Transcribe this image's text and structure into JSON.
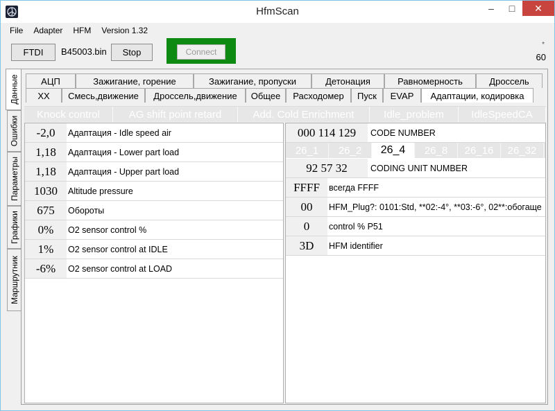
{
  "window": {
    "title": "HfmScan",
    "minimize": "–",
    "maximize": "□",
    "close": "✕"
  },
  "menu": [
    "File",
    "Adapter",
    "HFM",
    "Version 1.32"
  ],
  "toolbar": {
    "ftdi": "FTDI",
    "file": "B45003.bin",
    "stop": "Stop",
    "connect": "Connect",
    "star": "*",
    "count": "60"
  },
  "vtabs": [
    "Данные",
    "Ошибки",
    "Параметры",
    "Графики",
    "Маршрутник"
  ],
  "tabs_row1": [
    "АЦП",
    "Зажигание, горение",
    "Зажигание, пропуски",
    "Детонация",
    "Равномерность",
    "Дроссель"
  ],
  "tabs_row2": [
    "ХХ",
    "Смесь,движение",
    "Дроссель,движение",
    "Общее",
    "Расходомер",
    "Пуск",
    "EVAP",
    "Адаптации, кодировка"
  ],
  "subtabs": [
    "Knock control",
    "AG shift point retard",
    "Add. Cold Enrichment",
    "Idle_problem",
    "IdleSpeedCA"
  ],
  "left_rows": [
    {
      "value": "-2,0",
      "label": "Адаптация - Idle speed air"
    },
    {
      "value": "1,18",
      "label": "Адаптация - Lower part load"
    },
    {
      "value": "1,18",
      "label": "Адаптация - Upper part load"
    },
    {
      "value": "1030",
      "label": "Altitude pressure"
    },
    {
      "value": "675",
      "label": "Обороты"
    },
    {
      "value": "0%",
      "label": "O2 sensor control %"
    },
    {
      "value": "1%",
      "label": "O2 sensor control at IDLE"
    },
    {
      "value": "-6%",
      "label": "O2 sensor control at LOAD"
    }
  ],
  "right": {
    "code_value": "000 114 129",
    "code_label": "CODE NUMBER",
    "subtabs": [
      "26_1",
      "26_2",
      "26_4",
      "26_8",
      "26_16",
      "26_32"
    ],
    "coding_value": "92 57 32",
    "coding_label": "CODING UNIT NUMBER",
    "rows": [
      {
        "value": "FFFF",
        "label": "всегда FFFF"
      },
      {
        "value": "00",
        "label": "HFM_Plug?: 0101:Std, **02:-4°, **03:-6°, 02**:обогаще"
      },
      {
        "value": "0",
        "label": "control % P51"
      },
      {
        "value": "3D",
        "label": "HFM identifier"
      }
    ]
  },
  "colors": {
    "connect_frame": "#0c8a12",
    "close_button": "#c7453e",
    "title_border": "#7ec4e8"
  }
}
